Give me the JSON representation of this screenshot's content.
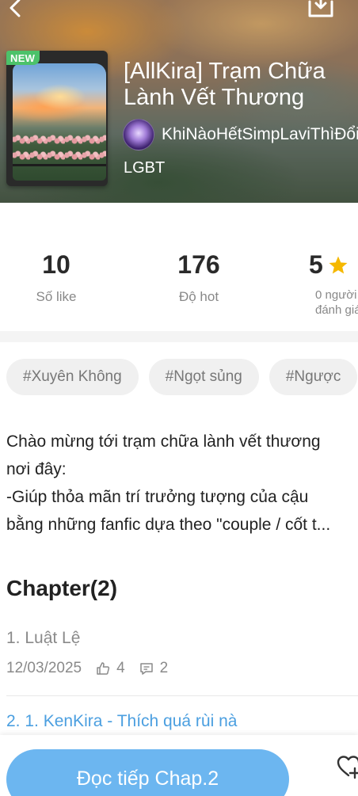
{
  "header": {
    "badge": "NEW",
    "title": "[AllKira] Trạm Chữa Lành Vết Thương",
    "author": "KhiNàoHếtSimpLaviThìĐổi",
    "genre": "LGBT"
  },
  "stats": {
    "likes": {
      "value": "10",
      "label": "Số like"
    },
    "hot": {
      "value": "176",
      "label": "Độ hot"
    },
    "rating": {
      "value": "5",
      "label_line1": "0 người",
      "label_line2": "đánh giá"
    }
  },
  "tags": [
    "#Xuyên Không",
    "#Ngọt sủng",
    "#Ngược"
  ],
  "description": {
    "lines": [
      "Chào mừng tới trạm chữa lành vết thương",
      "nơi đây:",
      "-Giúp thỏa mãn trí trưởng tượng của cậu",
      "bằng những fanfic dựa theo \"couple / cốt t..."
    ]
  },
  "chapters": {
    "heading": "Chapter(2)",
    "items": [
      {
        "title": "1. Luật Lệ",
        "date": "12/03/2025",
        "likes": "4",
        "comments": "2"
      },
      {
        "title": "2. 1. KenKira - Thích quá rùi nà"
      }
    ]
  },
  "bottom": {
    "read_button": "Đọc tiếp Chap.2"
  },
  "colors": {
    "accent": "#6cb6f0",
    "link": "#4b9fe0",
    "new_badge": "#4cc26a",
    "star": "#f5b800"
  },
  "icons": {
    "back": "chevron-left-icon",
    "download": "download-icon",
    "star": "star-icon",
    "like": "thumb-up-icon",
    "comment": "comment-icon",
    "follow": "heart-plus-icon"
  }
}
